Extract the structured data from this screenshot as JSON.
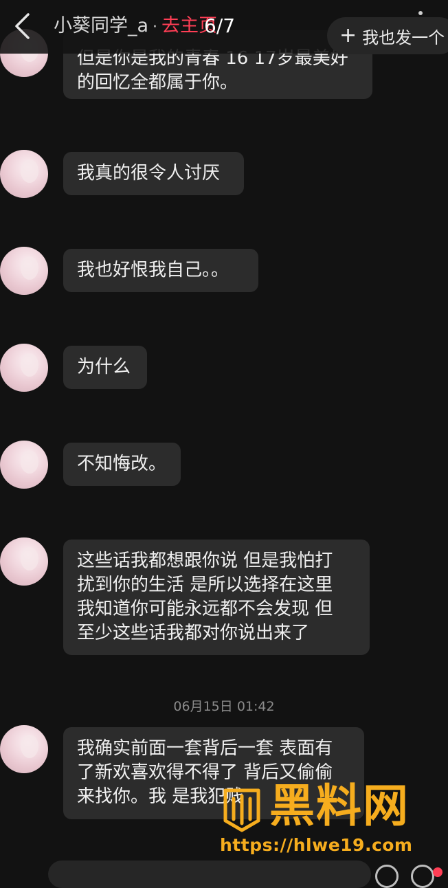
{
  "header": {
    "title": "小葵同学_a",
    "separator": "·",
    "home_link": "去主页",
    "pager": "6/7",
    "post_button": "我也发一个",
    "post_button_icon": "+"
  },
  "messages": [
    {
      "lines": [
        "但是你是我的青春 16 17岁最美好",
        "的回忆全都属于你。"
      ]
    },
    {
      "lines": [
        "我真的很令人讨厌"
      ]
    },
    {
      "lines": [
        "我也好恨我自己。。"
      ]
    },
    {
      "lines": [
        "为什么"
      ]
    },
    {
      "lines": [
        "不知悔改。"
      ]
    },
    {
      "lines": [
        "这些话我都想跟你说 但是我怕打",
        "扰到你的生活 是所以选择在这里",
        "我知道你可能永远都不会发现 但",
        "至少这些话我都对你说出来了"
      ]
    },
    {
      "lines": [
        "我确实前面一套背后一套 表面有",
        "了新欢喜欢得不得了 背后又偷偷",
        "来找你。我 是我犯贱"
      ]
    }
  ],
  "timestamp": "06月15日 01:42",
  "watermark": {
    "text": "黑料网",
    "url": "https://hlwe19.com",
    "color": "#f6ad1e"
  },
  "colors": {
    "background": "#121212",
    "bubble": "#2c2c2c",
    "accent": "#ff3e55"
  }
}
